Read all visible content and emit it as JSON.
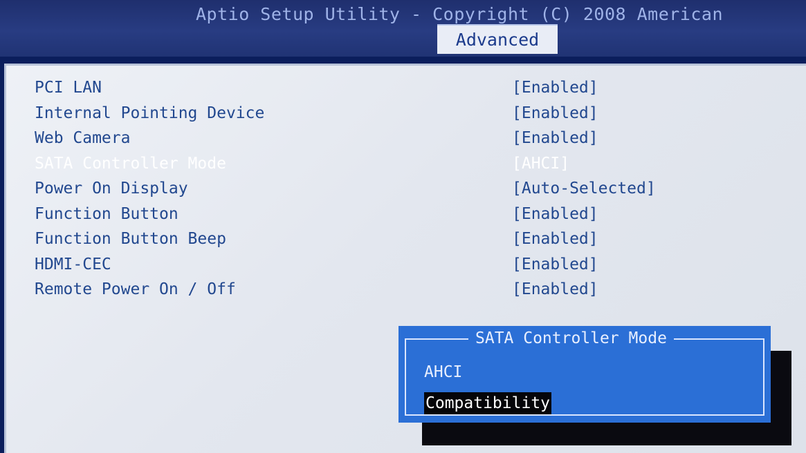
{
  "header": {
    "title": "Aptio Setup Utility - Copyright (C) 2008 American",
    "active_tab": "Advanced"
  },
  "settings": [
    {
      "label": "PCI LAN",
      "value": "[Enabled]"
    },
    {
      "label": "Internal Pointing Device",
      "value": "[Enabled]"
    },
    {
      "label": "Web Camera",
      "value": "[Enabled]"
    },
    {
      "label": "SATA Controller Mode",
      "value": "[AHCI]",
      "selected": true
    },
    {
      "label": "Power On Display",
      "value": "[Auto-Selected]"
    },
    {
      "label": "Function Button",
      "value": "[Enabled]"
    },
    {
      "label": "Function Button Beep",
      "value": "[Enabled]"
    },
    {
      "label": "HDMI-CEC",
      "value": "[Enabled]"
    },
    {
      "label": "Remote Power On / Off",
      "value": "[Enabled]"
    }
  ],
  "popup": {
    "title": "SATA Controller Mode",
    "options": [
      "AHCI",
      "Compatibility"
    ],
    "highlighted": "Compatibility"
  },
  "colors": {
    "header_bg": "#283c82",
    "panel_bg": "#e6e9f0",
    "text": "#22488f",
    "popup_bg": "#2b6fd6",
    "highlight_bg": "#050509"
  }
}
